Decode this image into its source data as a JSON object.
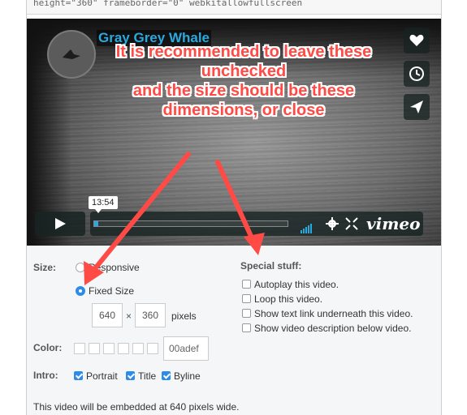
{
  "code_snippet": "height=\"360\" frameborder=\"0\" webkitallowfullscreen",
  "player": {
    "video_title": "Gray Grey Whale",
    "time_label": "13:54",
    "logo_text": "vimeo",
    "progress_fraction": 0.02,
    "icons": {
      "like": "heart-icon",
      "later": "clock-icon",
      "share": "paper-plane-icon",
      "play": "play-icon",
      "volume": "volume-bars-icon",
      "settings": "gear-icon",
      "fullscreen": "fullscreen-icon"
    }
  },
  "annotation": {
    "lines": [
      "It is recommended to leave these",
      "unchecked",
      "and the size should be these",
      "dimensions, or close"
    ],
    "color": "#ff4a45"
  },
  "options": {
    "size_label": "Size:",
    "responsive_label": "Responsive",
    "fixed_size_label": "Fixed Size",
    "width_value": "640",
    "times_sign": "×",
    "height_value": "360",
    "pixels_label": "pixels",
    "color_label": "Color:",
    "or_label": "or",
    "color_value": "00adef",
    "intro_label": "Intro:",
    "intro_options": {
      "portrait": "Portrait",
      "title": "Title",
      "byline": "Byline"
    },
    "special_heading": "Special stuff:",
    "special_items": {
      "autoplay": "Autoplay this video.",
      "loop": "Loop this video.",
      "text_link": "Show text link underneath this video.",
      "description": "Show video description below video."
    },
    "embed_info": "This video will be embedded at 640 pixels wide."
  },
  "colors": {
    "accent": "#2e8be8",
    "vimeo_blue": "#2aa9e0"
  }
}
